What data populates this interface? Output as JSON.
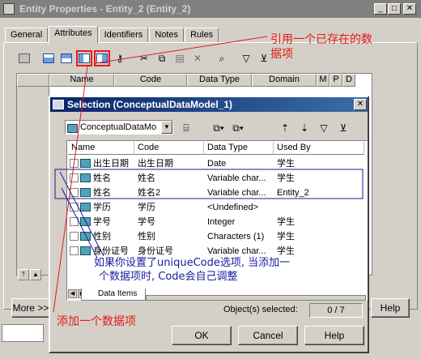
{
  "outer_window": {
    "title": "Entity Properties - Entity_2 (Entity_2)",
    "tabs": [
      {
        "label": "General"
      },
      {
        "label": "Attributes"
      },
      {
        "label": "Identifiers"
      },
      {
        "label": "Notes"
      },
      {
        "label": "Rules"
      }
    ],
    "columns": [
      "Name",
      "Code",
      "Data Type",
      "Domain",
      "M",
      "P",
      "D"
    ],
    "more_button": "More >>",
    "help_button": "Help"
  },
  "annotations": {
    "reuse_line1": "引用一个已存在的数",
    "reuse_line2": "据项",
    "add_item": "添加一个数据项",
    "uniquecode_line1": "如果你设置了uniqueCode选项, 当添加一",
    "uniquecode_line2": "个数据项时, Code会自己调整",
    "colors": {
      "red": "#e41b1b",
      "blue": "#1a1aa0"
    }
  },
  "dialog": {
    "title": "Selection (ConceptualDataModel_1)",
    "model_combo_value": "ConceptualDataMo",
    "columns": [
      "Name",
      "Code",
      "Data Type",
      "Used By"
    ],
    "rows": [
      {
        "name": "出生日期",
        "code": "出生日期",
        "type": "Date",
        "used_by": "学生"
      },
      {
        "name": "姓名",
        "code": "姓名",
        "type": "Variable char...",
        "used_by": "学生"
      },
      {
        "name": "姓名",
        "code": "姓名2",
        "type": "Variable char...",
        "used_by": "Entity_2"
      },
      {
        "name": "学历",
        "code": "学历",
        "type": "<Undefined>",
        "used_by": ""
      },
      {
        "name": "学号",
        "code": "学号",
        "type": "Integer",
        "used_by": "学生"
      },
      {
        "name": "性别",
        "code": "性别",
        "type": "Characters (1)",
        "used_by": "学生"
      },
      {
        "name": "身份证号",
        "code": "身份证号",
        "type": "Variable char...",
        "used_by": "学生"
      }
    ],
    "bottom_tab": "Data Items",
    "status_label": "Object(s) selected:",
    "status_value": "0 / 7",
    "ok_button": "OK",
    "cancel_button": "Cancel",
    "help_button": "Help"
  }
}
